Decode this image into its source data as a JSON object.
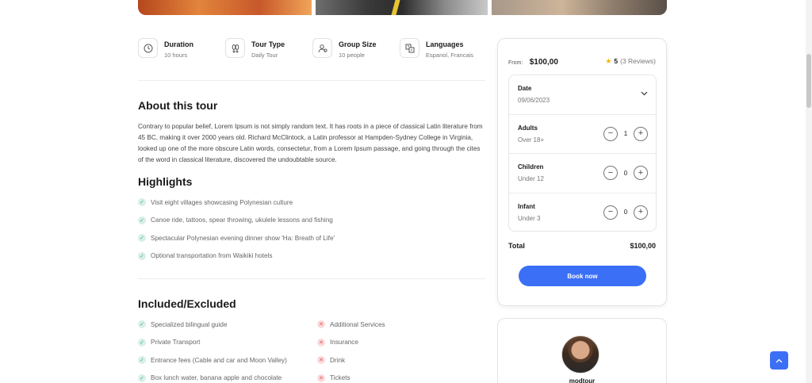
{
  "facts": [
    {
      "title": "Duration",
      "value": "10 hours",
      "icon": "clock-icon"
    },
    {
      "title": "Tour Type",
      "value": "Daily Tour",
      "icon": "footprints-icon"
    },
    {
      "title": "Group Size",
      "value": "10 people",
      "icon": "group-icon"
    },
    {
      "title": "Languages",
      "value": "Espanol, Francais",
      "icon": "translate-icon"
    }
  ],
  "about": {
    "heading": "About this tour",
    "text": "Contrary to popular belief, Lorem Ipsum is not simply random text. It has roots in a piece of classical Latin literature from 45 BC, making it over 2000 years old. Richard McClintock, a Latin professor at Hampden-Sydney College in Virginia, looked up one of the more obscure Latin words, consectetur, from a Lorem Ipsum passage, and going through the cites of the word in classical literature, discovered the undoubtable source."
  },
  "highlights": {
    "heading": "Highlights",
    "items": [
      "Visit eight villages showcasing Polynesian culture",
      "Canoe ride, tattoos, spear throwing, ukulele lessons and fishing",
      "Spectacular Polynesian evening dinner show 'Ha: Breath of Life'",
      "Optional transportation from Waikiki hotels"
    ]
  },
  "included": {
    "heading": "Included/Excluded",
    "included_items": [
      "Specialized bilingual guide",
      "Private Transport",
      "Entrance fees (Cable and car and Moon Valley)",
      "Box lunch water, banana apple and chocolate"
    ],
    "excluded_items": [
      "Additional Services",
      "Insurance",
      "Drink",
      "Tickets"
    ]
  },
  "booking": {
    "from_label": "From:",
    "from_price": "$100,00",
    "rating": "5",
    "reviews": "(3 Reviews)",
    "date_label": "Date",
    "date_value": "09/06/2023",
    "adults_label": "Adults",
    "adults_sub": "Over 18+",
    "adults_count": "1",
    "children_label": "Children",
    "children_sub": "Under 12",
    "children_count": "0",
    "infant_label": "Infant",
    "infant_sub": "Under 3",
    "infant_count": "0",
    "total_label": "Total",
    "total_value": "$100,00",
    "book_label": "Book now"
  },
  "host": {
    "name": "modtour"
  },
  "colors": {
    "accent": "#3b6ff6",
    "check": "#3fb08a",
    "cross": "#e25a5a",
    "star": "#f5b400"
  }
}
